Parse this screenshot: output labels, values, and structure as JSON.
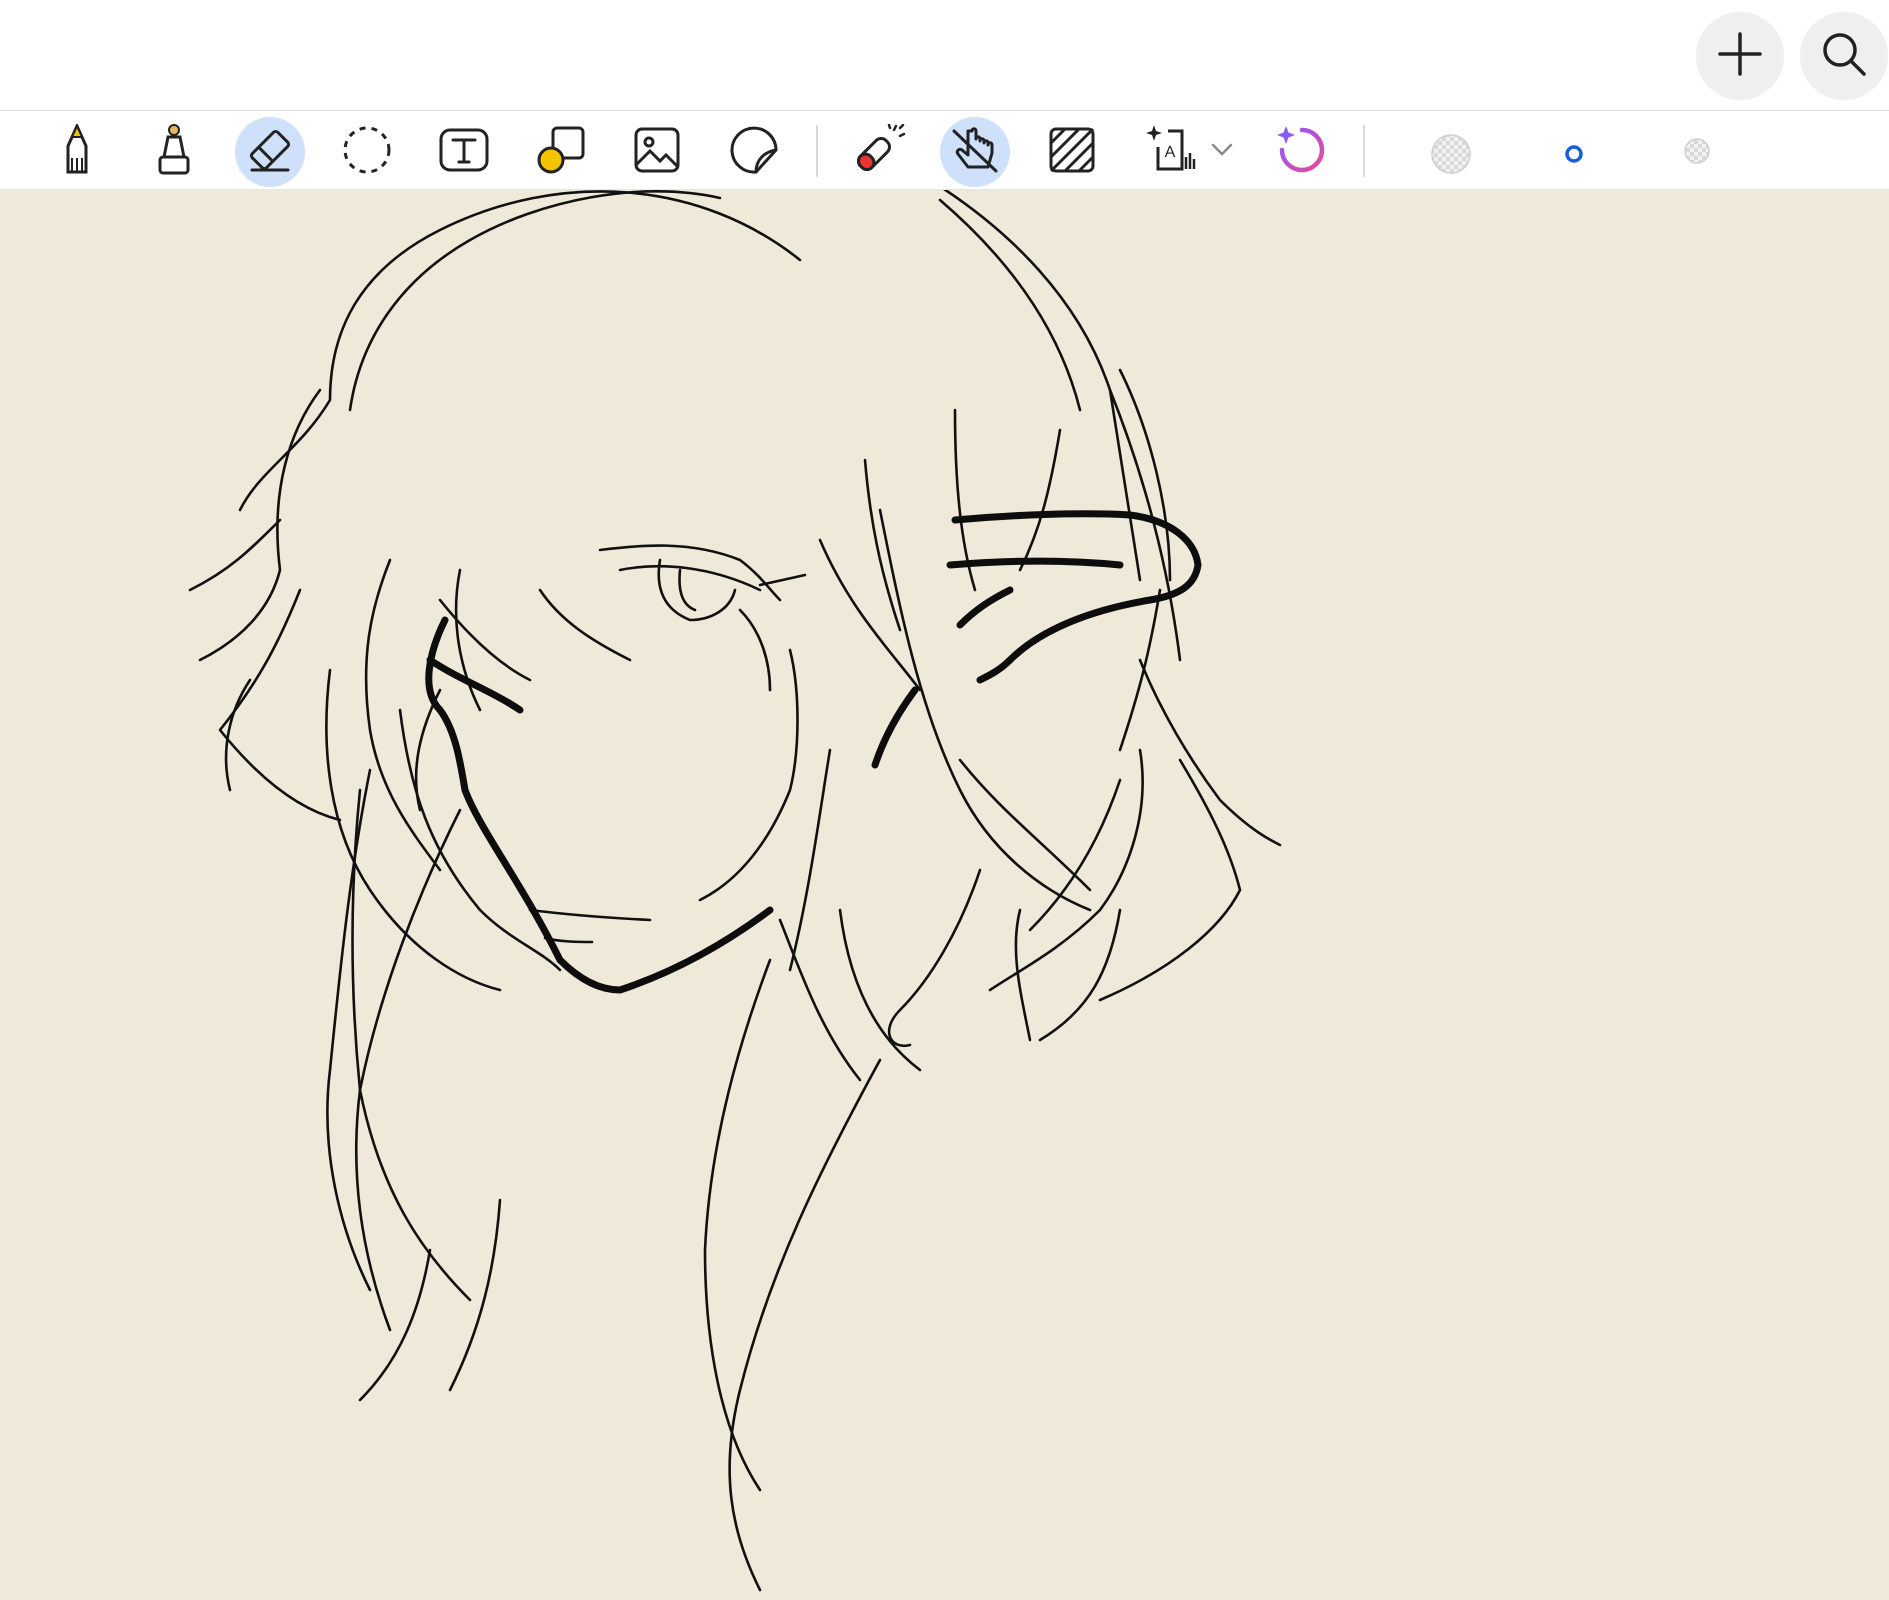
{
  "app": {
    "title": "",
    "accent_color": "#1a5fd6",
    "active_tool_bg": "#cfe0fb",
    "canvas_color": "#efe9da"
  },
  "topbar": {
    "buttons": [
      {
        "icon": "plus-icon",
        "label": ""
      },
      {
        "icon": "search-icon",
        "label": ""
      }
    ]
  },
  "toolbar": {
    "tools": [
      {
        "icon": "pencil-icon",
        "active": false
      },
      {
        "icon": "marker-icon",
        "active": false
      },
      {
        "icon": "eraser-icon",
        "active": true
      },
      {
        "icon": "lasso-select-icon",
        "active": false
      },
      {
        "icon": "text-box-icon",
        "active": false
      },
      {
        "icon": "shapes-icon",
        "active": false
      },
      {
        "icon": "image-icon",
        "active": false
      },
      {
        "icon": "sticker-icon",
        "active": false
      },
      {
        "icon": "laser-pointer-icon",
        "active": false
      },
      {
        "icon": "touch-drawing-icon",
        "active": true
      },
      {
        "icon": "pattern-fill-icon",
        "active": false
      },
      {
        "icon": "text-recognition-icon",
        "active": false
      },
      {
        "icon": "ai-assist-icon",
        "active": false
      }
    ],
    "swatches": [
      {
        "name": "transparent-swatch-large",
        "color": "transparent"
      },
      {
        "name": "blue-ring-swatch",
        "color": "#1a5fd6"
      },
      {
        "name": "transparent-swatch-small",
        "color": "transparent"
      }
    ]
  },
  "canvas": {
    "content": "sketch"
  }
}
